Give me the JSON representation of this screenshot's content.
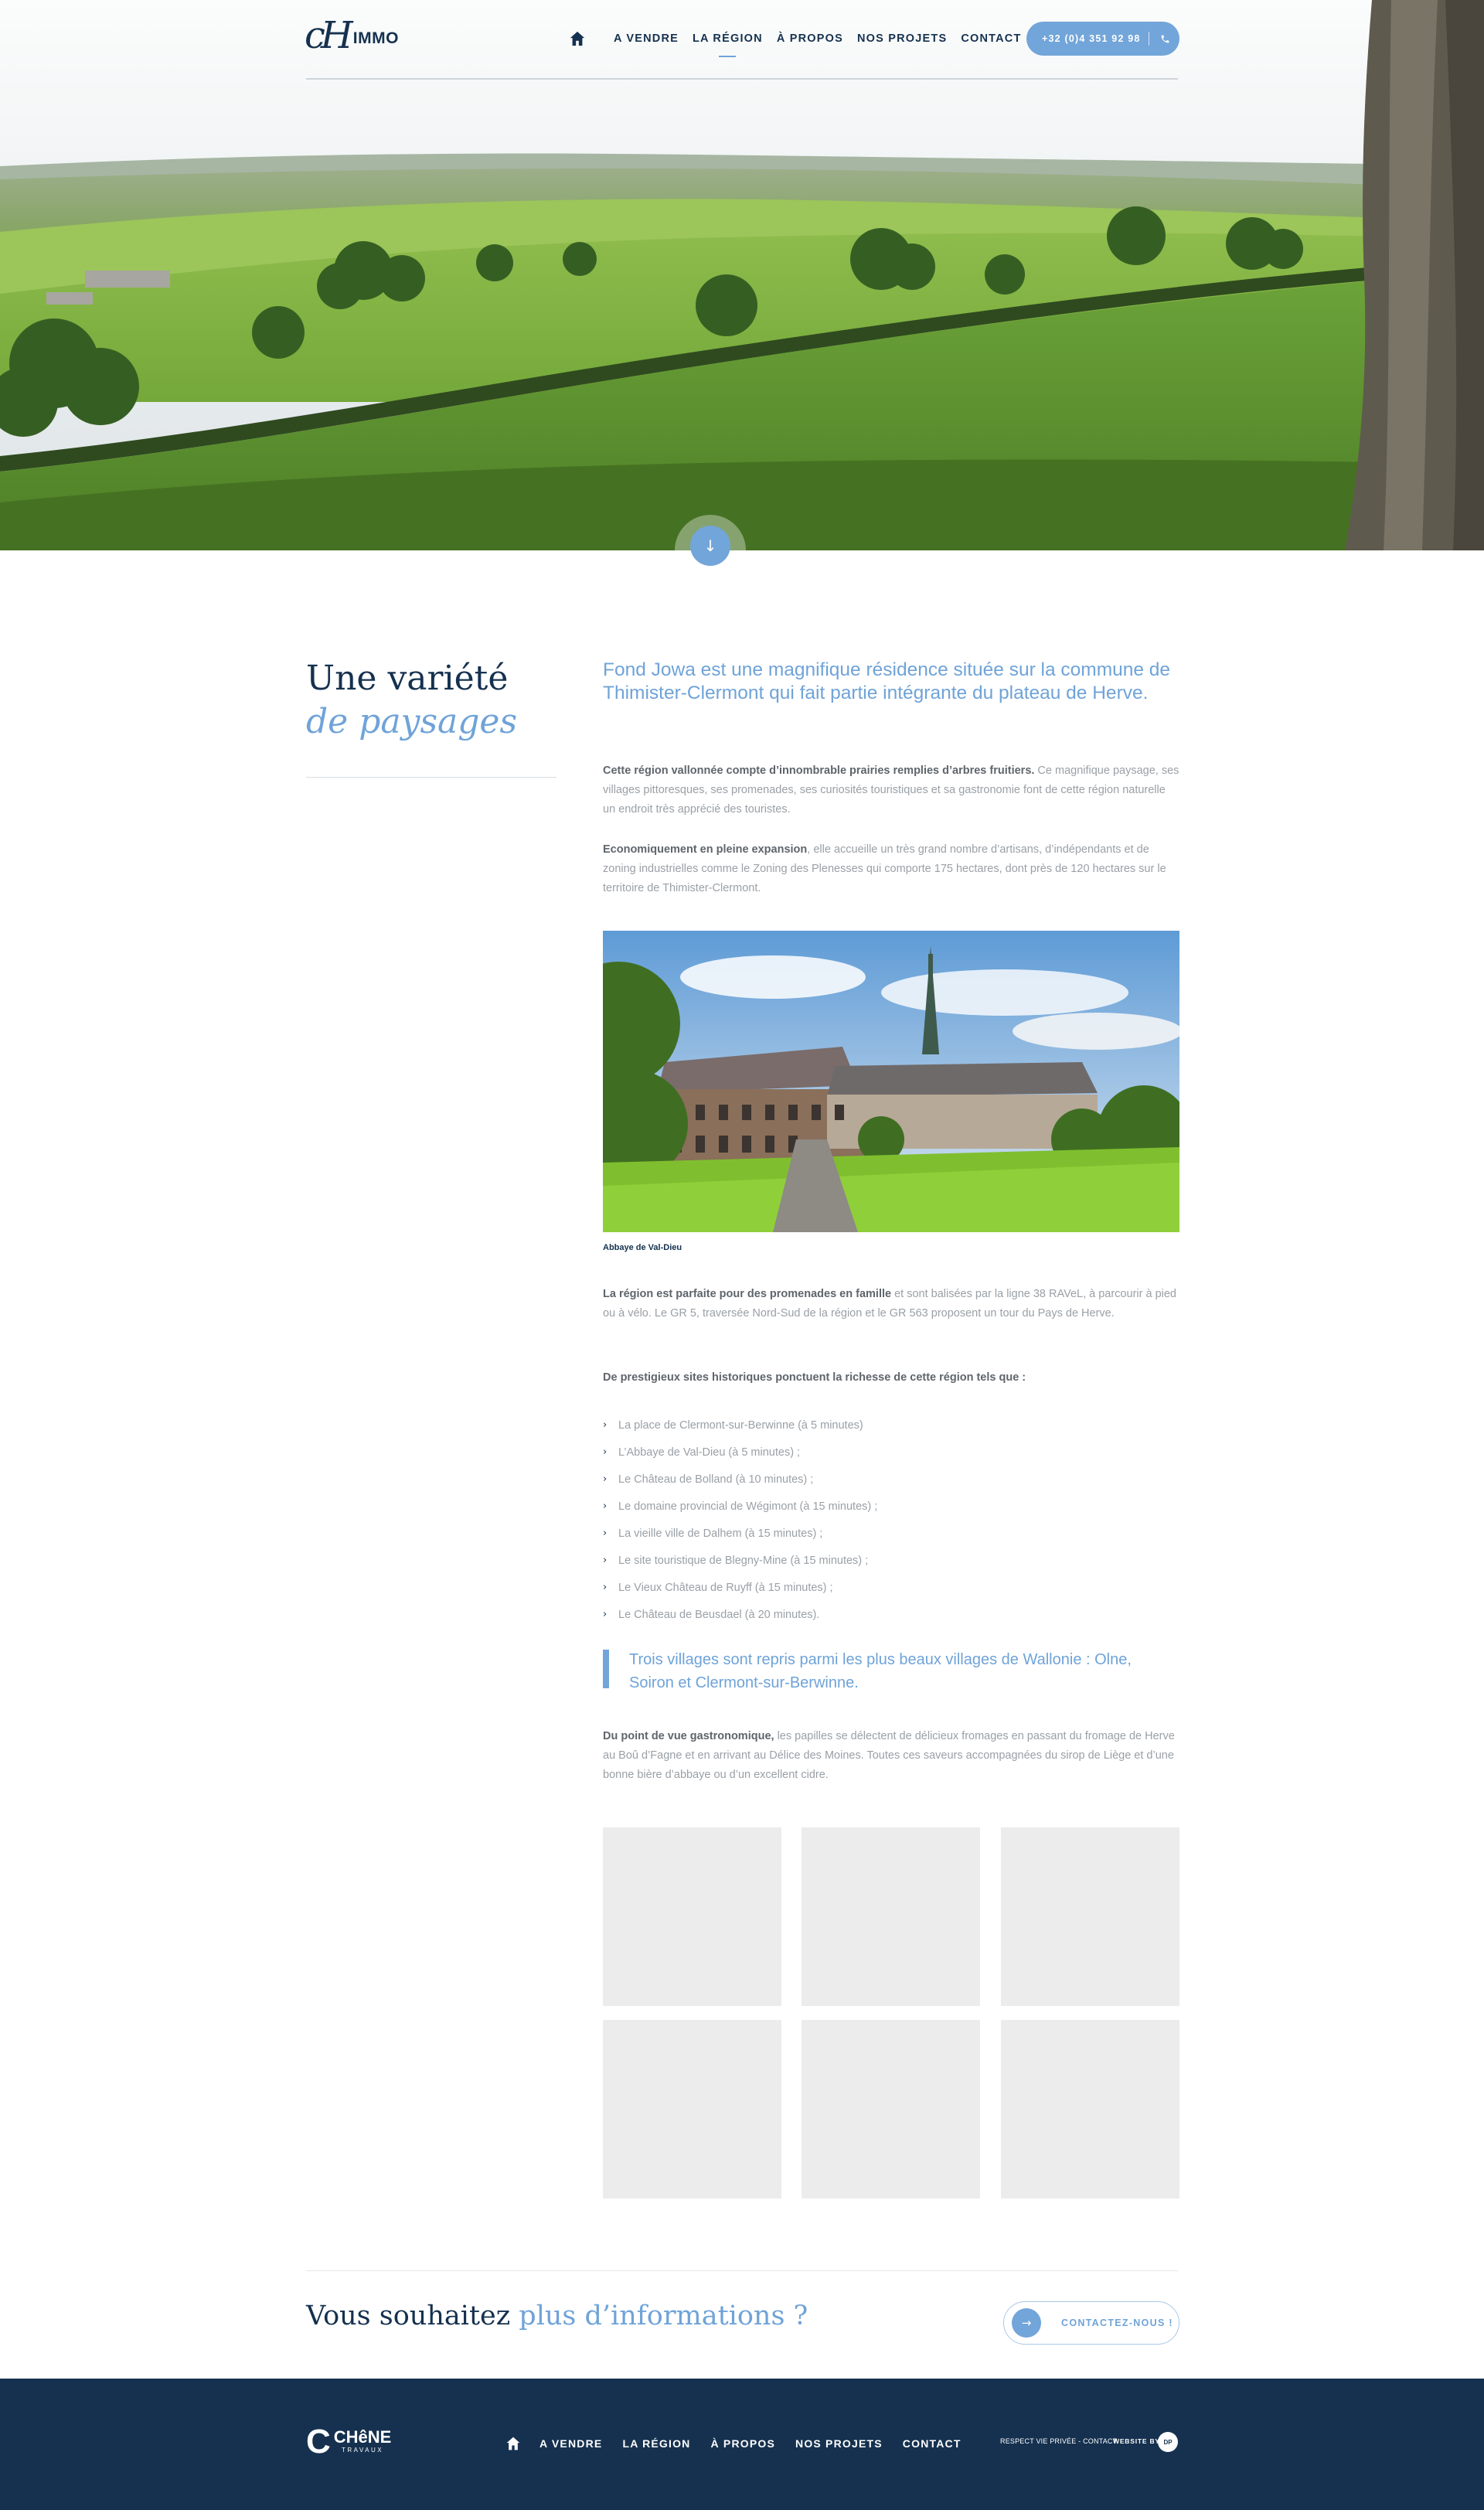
{
  "brand": {
    "logo_mark": "cH",
    "logo_word": "IMMO"
  },
  "nav": {
    "items": [
      {
        "label": "A VENDRE"
      },
      {
        "label": "LA RÉGION"
      },
      {
        "label": "À PROPOS"
      },
      {
        "label": "NOS PROJETS"
      },
      {
        "label": "CONTACT"
      }
    ],
    "phone": "+32 (0)4 351 92 98"
  },
  "section": {
    "title_line1": "Une variété",
    "title_line2": "de paysages",
    "lead": "Fond Jowa est une magnifique résidence située sur la commune de Thimister-Clermont qui fait partie intégrante du plateau de Herve.",
    "p1_bold": "Cette région vallonnée compte d’innombrable prairies remplies d’arbres fruitiers.",
    "p1_text": " Ce magnifique paysage, ses villages pittoresques, ses promenades, ses curiosités touristiques et sa gastronomie font de cette région naturelle un endroit très apprécié des touristes.",
    "p2_bold": "Economiquement en pleine expansion",
    "p2_text": ", elle accueille un très grand nombre d’artisans, d’indépendants et de zoning industrielles comme le Zoning des Plenesses qui comporte 175 hectares, dont près de 120 hectares sur le territoire de Thimister-Clermont.",
    "photo_caption": "Abbaye de Val-Dieu",
    "p3_bold": "La région est parfaite pour des promenades en famille",
    "p3_text": " et sont balisées par la ligne 38 RAVeL, à parcourir à pied ou à vélo. Le GR 5, traversée Nord-Sud de la région et le GR 563 proposent un tour du Pays de Herve.",
    "p4_bold": "De prestigieux sites historiques ponctuent la richesse de cette région tels que :",
    "sites": [
      "La place de Clermont-sur-Berwinne (à 5 minutes)",
      "L’Abbaye de Val-Dieu  (à 5 minutes) ;",
      "Le Château de Bolland (à 10 minutes) ;",
      "Le domaine provincial de Wégimont (à 15 minutes) ;",
      "La vieille ville de Dalhem (à 15 minutes) ;",
      "Le site touristique de Blegny-Mine (à 15 minutes) ;",
      "Le Vieux Château de Ruyff (à 15 minutes) ;",
      "Le Château de Beusdael (à 20 minutes)."
    ],
    "quote": "Trois villages sont repris parmi les plus beaux villages de Wallonie : Olne, Soiron et Clermont-sur-Berwinne.",
    "p5_bold": "Du point de vue gastronomique,",
    "p5_text": " les papilles se délectent de délicieux fromages en passant du fromage de Herve au Boû d’Fagne et en arrivant au Délice des Moines. Toutes ces saveurs accompagnées du sirop de Liège et d’une bonne bière d’abbaye ou d’un excellent cidre."
  },
  "info": {
    "title_plain": "Vous souhaitez ",
    "title_accent": "plus d’informations ?",
    "button": "CONTACTEZ-NOUS !"
  },
  "footer": {
    "logo_c": "C",
    "logo_word": "CHêNE",
    "logo_sub": "TRAVAUX",
    "nav": [
      "A VENDRE",
      "LA RÉGION",
      "À PROPOS",
      "NOS PROJETS",
      "CONTACT"
    ],
    "legal": "RESPECT VIE PRIVÉE - CONTACT",
    "website_by": "WEBSITE BY",
    "badge": "DP"
  },
  "colors": {
    "navy": "#15314f",
    "accent": "#72a5d9",
    "text": "#9aa0a6"
  }
}
